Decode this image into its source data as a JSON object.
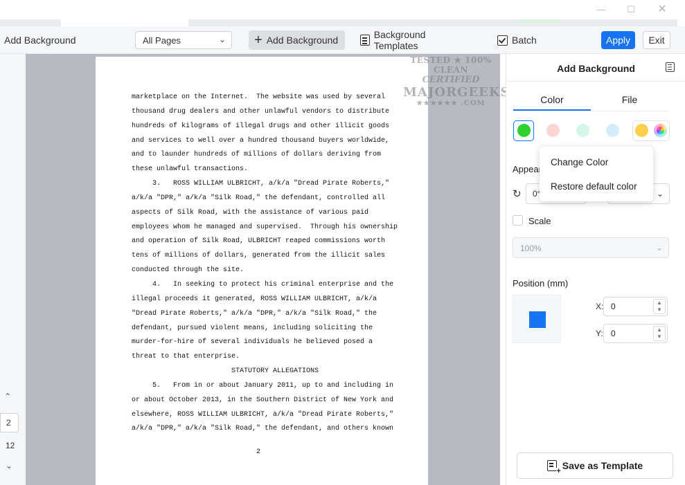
{
  "window": {
    "minimize": "—",
    "maximize": "☐",
    "close": "✕"
  },
  "toolbar": {
    "title": "Add Background",
    "page_range": "All Pages",
    "add_background": "Add Background",
    "background_templates": "Background Templates",
    "batch": "Batch",
    "apply": "Apply",
    "exit": "Exit"
  },
  "leftnav": {
    "current_page": "2",
    "total_pages": "12"
  },
  "document": {
    "lines": [
      "marketplace on the Internet.  The website was used by several",
      "thousand drug dealers and other unlawful vendors to distribute",
      "hundreds of kilograms of illegal drugs and other illicit goods",
      "and services to well over a hundred thousand buyers worldwide,",
      "and to launder hundreds of millions of dollars deriving from",
      "these unlawful transactions.",
      "     3.   ROSS WILLIAM ULBRICHT, a/k/a \"Dread Pirate Roberts,\"",
      "a/k/a \"DPR,\" a/k/a \"Silk Road,\" the defendant, controlled all",
      "aspects of Silk Road, with the assistance of various paid",
      "employees whom he managed and supervised.  Through his ownership",
      "and operation of Silk Road, ULBRICHT reaped commissions worth",
      "tens of millions of dollars, generated from the illicit sales",
      "conducted through the site.",
      "     4.   In seeking to protect his criminal enterprise and the",
      "illegal proceeds it generated, ROSS WILLIAM ULBRICHT, a/k/a",
      "\"Dread Pirate Roberts,\" a/k/a \"DPR,\" a/k/a \"Silk Road,\" the",
      "defendant, pursued violent means, including soliciting the",
      "murder-for-hire of several individuals he believed posed a",
      "threat to that enterprise.",
      "                        STATUTORY ALLEGATIONS",
      "     5.   From in or about January 2011, up to and including in",
      "or about October 2013, in the Southern District of New York and",
      "elsewhere, ROSS WILLIAM ULBRICHT, a/k/a \"Dread Pirate Roberts,\"",
      "a/k/a \"DPR,\" a/k/a \"Silk Road,\" the defendant, and others known"
    ],
    "page_number": "2"
  },
  "watermark": {
    "line1": "TESTED ★ 100% CLEAN",
    "line2": "CERTIFIED",
    "line3": "MAJORGEEKS",
    "line4": "★★★★★★ .COM"
  },
  "panel": {
    "title": "Add Background",
    "tabs": {
      "color": "Color",
      "file": "File"
    },
    "swatches": [
      "#2ed12e",
      "#fbd4d4",
      "#d4f6e8",
      "#d3ecfb",
      "#fcd04a"
    ],
    "appearance_label": "Appear",
    "rotation_value": "0°",
    "scale_label": "Scale",
    "scale_value": "100%",
    "position_label": "Position (mm)",
    "x_label": "X:",
    "x_value": "0",
    "y_label": "Y:",
    "y_value": "0",
    "save_template": "Save as Template"
  },
  "context_menu": {
    "change_color": "Change Color",
    "restore_default": "Restore default color"
  },
  "colors": {
    "accent": "#1673f2",
    "viewer_bg": "#b7bac1"
  }
}
